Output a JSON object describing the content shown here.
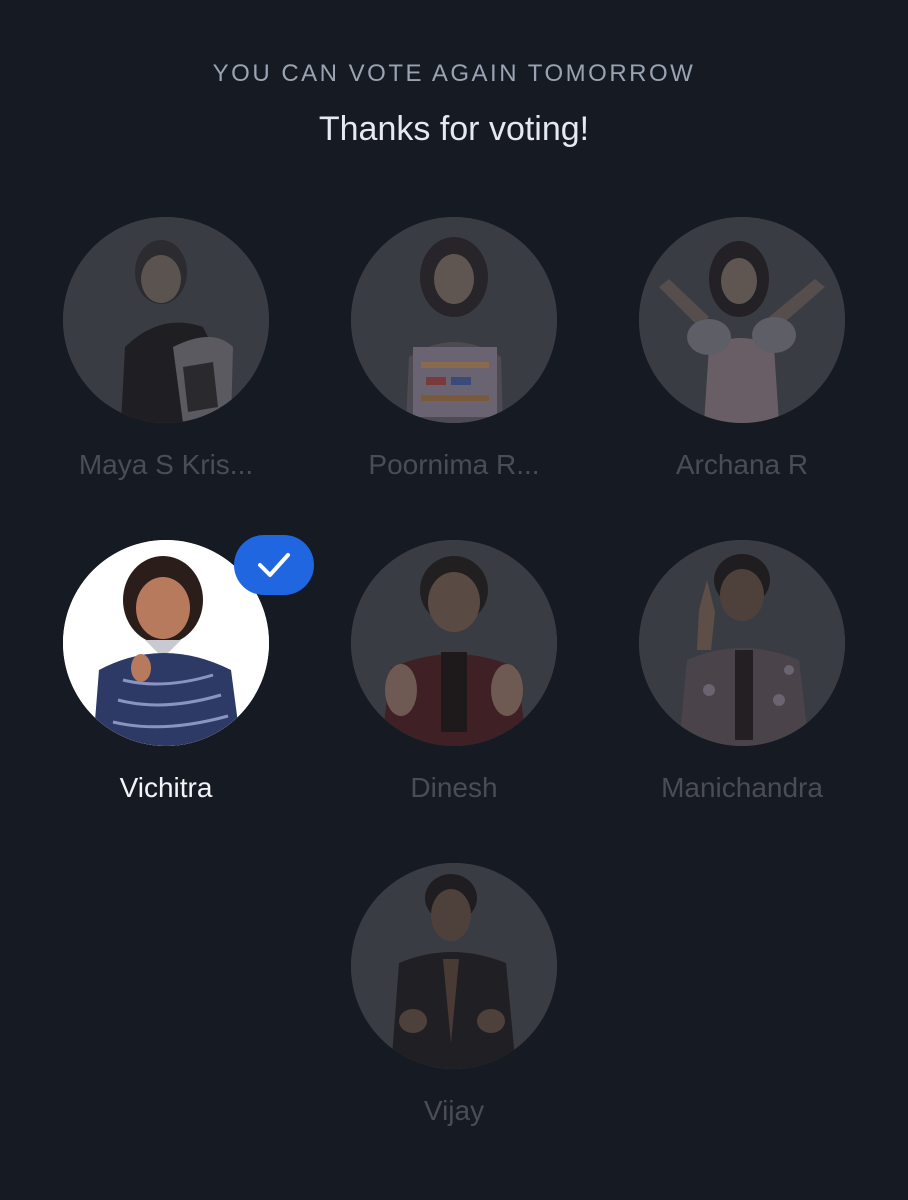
{
  "header": {
    "subtitle": "YOU CAN VOTE AGAIN TOMORROW",
    "title": "Thanks for voting!"
  },
  "contestants": [
    {
      "name": "Maya S Kris...",
      "selected": false,
      "avatar_icon": "contestant-photo"
    },
    {
      "name": "Poornima R...",
      "selected": false,
      "avatar_icon": "contestant-photo"
    },
    {
      "name": "Archana R",
      "selected": false,
      "avatar_icon": "contestant-photo"
    },
    {
      "name": "Vichitra",
      "selected": true,
      "avatar_icon": "contestant-photo"
    },
    {
      "name": "Dinesh",
      "selected": false,
      "avatar_icon": "contestant-photo"
    },
    {
      "name": "Manichandra",
      "selected": false,
      "avatar_icon": "contestant-photo"
    },
    {
      "name": "Vijay",
      "selected": false,
      "avatar_icon": "contestant-photo"
    }
  ],
  "colors": {
    "background": "#161a22",
    "selected_badge": "#1f66e0",
    "selected_name": "#f2f4f7",
    "dimmed_name": "#4a4d55"
  },
  "selected_indicator_icon": "checkmark-icon"
}
